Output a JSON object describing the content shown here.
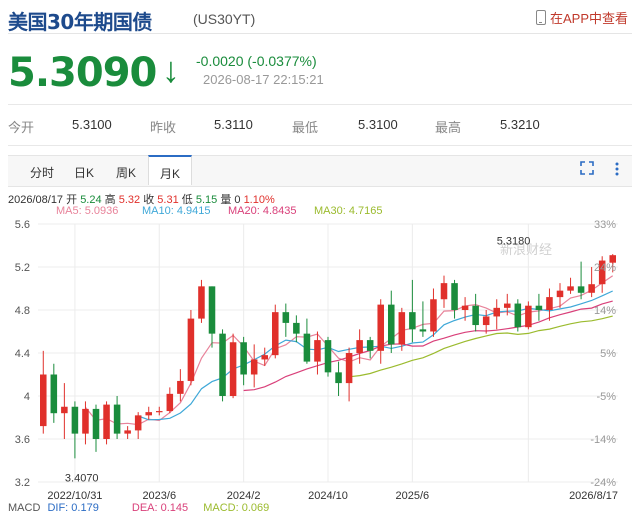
{
  "header": {
    "title": "美国30年期国债",
    "code": "(US30YT)",
    "app_link": "在APP中查看"
  },
  "quote": {
    "price": "5.3090",
    "direction_arrow": "↓",
    "change": "-0.0020 (-0.0377%)",
    "timestamp": "2026-08-17 22:15:21"
  },
  "stats": [
    {
      "label": "今开",
      "value": "5.3100"
    },
    {
      "label": "昨收",
      "value": "5.3110"
    },
    {
      "label": "最低",
      "value": "5.3100"
    },
    {
      "label": "最高",
      "value": "5.3210"
    }
  ],
  "tabs": [
    {
      "label": "分时"
    },
    {
      "label": "日K"
    },
    {
      "label": "周K"
    },
    {
      "label": "月K"
    }
  ],
  "controls": {
    "fullscreen_icon": "fullscreen-icon",
    "more_icon": "more-icon"
  },
  "ohlc": {
    "date": "2026/08/17",
    "open_label": "开",
    "open": "5.24",
    "high_label": "高",
    "high": "5.32",
    "close_label": "收",
    "close": "5.31",
    "low_label": "低",
    "low": "5.15",
    "vol_label": "量",
    "vol": "0",
    "pct": "1.10%"
  },
  "ma": [
    {
      "text": "MA5: 5.0936",
      "color": "#e8839a"
    },
    {
      "text": "MA10: 4.9415",
      "color": "#3fa8d8"
    },
    {
      "text": "MA20: 4.8435",
      "color": "#d9407a"
    },
    {
      "text": "MA30: 4.7165",
      "color": "#9bbb2e"
    }
  ],
  "macd": {
    "label": "MACD",
    "dif": "DIF: 0.179",
    "dea": "DEA: 0.145",
    "macd": "MACD: 0.069"
  },
  "watermark": "新浪财经",
  "colors": {
    "up": "#e0302b",
    "down": "#1a8c3c",
    "accent": "#2b6cc4",
    "title": "#1d4a8c"
  },
  "chart_data": {
    "type": "candlestick",
    "ylim": [
      3.2,
      5.6
    ],
    "y_ticks": [
      "5.6",
      "5.2",
      "4.8",
      "4.4",
      "4",
      "3.6",
      "3.2"
    ],
    "y_tick_values": [
      5.6,
      5.2,
      4.8,
      4.4,
      4.0,
      3.6,
      3.2
    ],
    "pct_ticks": [
      "33%",
      "24%",
      "14%",
      "5%",
      "-5%",
      "-14%",
      "-24%"
    ],
    "x_ticks": [
      "2022/10/31",
      "2023/6",
      "2024/2",
      "2024/10",
      "2025/6",
      "2026/8/17"
    ],
    "x_tick_index": [
      3,
      11,
      19,
      27,
      35,
      46
    ],
    "annotations": {
      "low_label": "3.4070",
      "low_index": 3,
      "low_value": 3.407,
      "high_label": "5.3180",
      "high_index": 46,
      "high_value": 5.318
    },
    "candles": [
      {
        "o": 3.72,
        "h": 4.42,
        "l": 3.65,
        "c": 4.2
      },
      {
        "o": 4.2,
        "h": 4.3,
        "l": 3.75,
        "c": 3.84
      },
      {
        "o": 3.84,
        "h": 4.12,
        "l": 3.6,
        "c": 3.9
      },
      {
        "o": 3.9,
        "h": 3.95,
        "l": 3.42,
        "c": 3.65
      },
      {
        "o": 3.65,
        "h": 3.95,
        "l": 3.55,
        "c": 3.88
      },
      {
        "o": 3.88,
        "h": 3.92,
        "l": 3.48,
        "c": 3.6
      },
      {
        "o": 3.6,
        "h": 3.95,
        "l": 3.55,
        "c": 3.92
      },
      {
        "o": 3.92,
        "h": 4.0,
        "l": 3.6,
        "c": 3.65
      },
      {
        "o": 3.65,
        "h": 3.72,
        "l": 3.6,
        "c": 3.68
      },
      {
        "o": 3.68,
        "h": 3.85,
        "l": 3.6,
        "c": 3.82
      },
      {
        "o": 3.82,
        "h": 3.9,
        "l": 3.78,
        "c": 3.85
      },
      {
        "o": 3.85,
        "h": 3.9,
        "l": 3.82,
        "c": 3.86
      },
      {
        "o": 3.86,
        "h": 4.08,
        "l": 3.84,
        "c": 4.02
      },
      {
        "o": 4.02,
        "h": 4.25,
        "l": 3.95,
        "c": 4.14
      },
      {
        "o": 4.14,
        "h": 4.8,
        "l": 4.1,
        "c": 4.72
      },
      {
        "o": 4.72,
        "h": 5.08,
        "l": 4.68,
        "c": 5.02
      },
      {
        "o": 5.02,
        "h": 5.0,
        "l": 4.45,
        "c": 4.58
      },
      {
        "o": 4.58,
        "h": 4.62,
        "l": 3.95,
        "c": 4.0
      },
      {
        "o": 4.0,
        "h": 4.58,
        "l": 3.98,
        "c": 4.5
      },
      {
        "o": 4.5,
        "h": 4.55,
        "l": 4.1,
        "c": 4.2
      },
      {
        "o": 4.2,
        "h": 4.48,
        "l": 4.08,
        "c": 4.34
      },
      {
        "o": 4.34,
        "h": 4.45,
        "l": 4.28,
        "c": 4.38
      },
      {
        "o": 4.38,
        "h": 4.85,
        "l": 4.35,
        "c": 4.78
      },
      {
        "o": 4.78,
        "h": 4.86,
        "l": 4.55,
        "c": 4.68
      },
      {
        "o": 4.68,
        "h": 4.75,
        "l": 4.5,
        "c": 4.58
      },
      {
        "o": 4.58,
        "h": 4.72,
        "l": 4.3,
        "c": 4.32
      },
      {
        "o": 4.32,
        "h": 4.6,
        "l": 4.2,
        "c": 4.52
      },
      {
        "o": 4.52,
        "h": 4.55,
        "l": 4.18,
        "c": 4.22
      },
      {
        "o": 4.22,
        "h": 4.32,
        "l": 4.0,
        "c": 4.12
      },
      {
        "o": 4.12,
        "h": 4.45,
        "l": 3.95,
        "c": 4.4
      },
      {
        "o": 4.4,
        "h": 4.62,
        "l": 4.3,
        "c": 4.52
      },
      {
        "o": 4.52,
        "h": 4.55,
        "l": 4.35,
        "c": 4.42
      },
      {
        "o": 4.42,
        "h": 4.9,
        "l": 4.3,
        "c": 4.85
      },
      {
        "o": 4.85,
        "h": 4.98,
        "l": 4.4,
        "c": 4.48
      },
      {
        "o": 4.48,
        "h": 4.82,
        "l": 4.42,
        "c": 4.78
      },
      {
        "o": 4.78,
        "h": 5.08,
        "l": 4.5,
        "c": 4.62
      },
      {
        "o": 4.62,
        "h": 4.88,
        "l": 4.55,
        "c": 4.6
      },
      {
        "o": 4.6,
        "h": 5.0,
        "l": 4.55,
        "c": 4.9
      },
      {
        "o": 4.9,
        "h": 5.12,
        "l": 4.82,
        "c": 5.05
      },
      {
        "o": 5.05,
        "h": 5.08,
        "l": 4.72,
        "c": 4.8
      },
      {
        "o": 4.8,
        "h": 4.92,
        "l": 4.7,
        "c": 4.84
      },
      {
        "o": 4.84,
        "h": 4.95,
        "l": 4.6,
        "c": 4.66
      },
      {
        "o": 4.66,
        "h": 4.8,
        "l": 4.58,
        "c": 4.74
      },
      {
        "o": 4.74,
        "h": 4.9,
        "l": 4.62,
        "c": 4.82
      },
      {
        "o": 4.82,
        "h": 4.95,
        "l": 4.75,
        "c": 4.86
      },
      {
        "o": 4.86,
        "h": 4.9,
        "l": 4.6,
        "c": 4.64
      },
      {
        "o": 4.64,
        "h": 4.88,
        "l": 4.62,
        "c": 4.84
      },
      {
        "o": 4.84,
        "h": 4.95,
        "l": 4.7,
        "c": 4.8
      },
      {
        "o": 4.8,
        "h": 5.0,
        "l": 4.7,
        "c": 4.92
      },
      {
        "o": 4.92,
        "h": 5.05,
        "l": 4.82,
        "c": 4.98
      },
      {
        "o": 4.98,
        "h": 5.1,
        "l": 4.95,
        "c": 5.02
      },
      {
        "o": 5.02,
        "h": 5.25,
        "l": 4.9,
        "c": 4.96
      },
      {
        "o": 4.96,
        "h": 5.2,
        "l": 4.92,
        "c": 5.04
      },
      {
        "o": 5.04,
        "h": 5.3,
        "l": 4.96,
        "c": 5.26
      },
      {
        "o": 5.24,
        "h": 5.32,
        "l": 5.15,
        "c": 5.31
      }
    ]
  }
}
